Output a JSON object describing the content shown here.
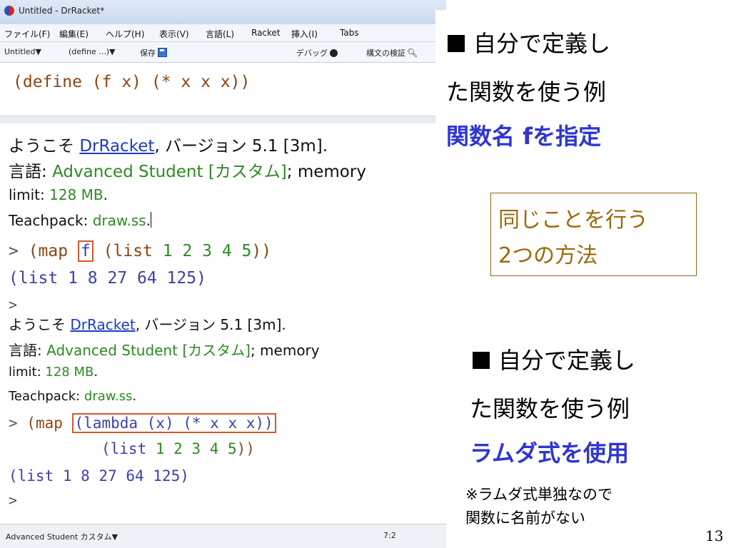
{
  "window": {
    "title": "Untitled - DrRacket*",
    "menus": [
      "ファイル(F)",
      "編集(E)",
      "ヘルプ(H)",
      "表示(V)",
      "言語(L)",
      "Racket",
      "挿入(I)",
      "Tabs"
    ],
    "toolbar": {
      "file_menu": "Untitled▼",
      "define_menu": "(define ...)▼",
      "save_label": "保存",
      "debug_label": "デバッグ",
      "check_syntax_label": "構文の検証"
    },
    "definitions": {
      "line1": "(define (f x) (* x x x))"
    },
    "interactions": {
      "block1": {
        "welcome_prefix": "ようこそ ",
        "welcome_link": "DrRacket",
        "welcome_suffix": ", バージョン 5.1 [3m].",
        "lang_label": "言語: ",
        "lang_value": "Advanced Student [カスタム]",
        "lang_suffix": "; memory",
        "limit_label": "limit: ",
        "limit_value": "128 MB",
        "limit_end": ".",
        "teachpack_label": "Teachpack: ",
        "teachpack_value": "draw.ss",
        "teachpack_end": ".",
        "prompt": "> ",
        "expr_open": "(map ",
        "expr_f": "f",
        "expr_list_open": " (list ",
        "expr_nums": "1 2 3 4 5",
        "expr_close": "))",
        "result": "(list 1 8 27 64 125)",
        "next_prompt": ">"
      },
      "block2": {
        "welcome_prefix": "ようこそ ",
        "welcome_link": "DrRacket",
        "welcome_suffix": ", バージョン 5.1 [3m].",
        "lang_label": "言語: ",
        "lang_value": "Advanced Student [カスタム]",
        "lang_suffix": "; memory",
        "limit_label": "limit: ",
        "limit_value": "128 MB",
        "limit_end": ".",
        "teachpack_label": "Teachpack: ",
        "teachpack_value": "draw.ss",
        "teachpack_end": ".",
        "prompt": "> ",
        "expr_open": "(map ",
        "lambda_expr": "(lambda (x) (* x x x))",
        "list_open": "(list ",
        "list_nums": "1 2 3 4 5",
        "list_close": "))",
        "result": "(list 1 8 27 64 125)",
        "next_prompt": ">"
      }
    },
    "status": {
      "language": "Advanced Student カスタム▼",
      "position": "7:2"
    }
  },
  "slide": {
    "note1": {
      "line1": "自分で定義し",
      "line2": "た関数を使う例",
      "line3": "関数名 fを指定"
    },
    "callout": {
      "line1": "同じことを行う",
      "line2": "2つの方法"
    },
    "note2": {
      "line1": "自分で定義し",
      "line2": "た関数を使う例",
      "line3": "ラムダ式を使用",
      "remark1": "※ラムダ式単独なので",
      "remark2": "関数に名前がない"
    },
    "page_number": "13"
  },
  "colors": {
    "blue_text": "#2f36d0",
    "callout_text": "#9b6a06",
    "highlight_box": "#d4572a",
    "green_value": "#2d8a22"
  }
}
